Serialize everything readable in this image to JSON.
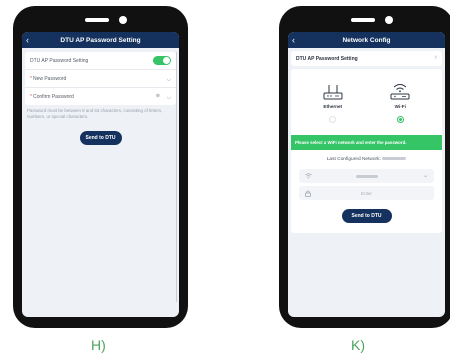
{
  "left_phone": {
    "header": {
      "back_icon": "chevron-left-icon",
      "title": "DTU AP Password Setting"
    },
    "settings": {
      "toggle_label": "DTU AP Password Setting",
      "toggle_on": true,
      "new_password": {
        "required_mark": "*",
        "placeholder": "New Password"
      },
      "confirm_password": {
        "required_mark": "*",
        "placeholder": "Confirm Password"
      }
    },
    "hint": "Password must be between 8 and 63 characters, consisting of letters, numbers, or special characters.",
    "send_button": "Send to DTU",
    "caption": "H)"
  },
  "right_phone": {
    "header": {
      "back_icon": "chevron-left-icon",
      "title": "Network Config"
    },
    "ap_row_label": "DTU AP Password Setting",
    "modes": [
      {
        "label": "Ethernet",
        "icon": "router-icon",
        "selected": false
      },
      {
        "label": "Wi-Fi",
        "icon": "wifi-router-icon",
        "selected": true
      }
    ],
    "banner": "Please select a WiFi network and enter the password.",
    "last_configured_label": "Last Configured Network:",
    "password_placeholder": "Enter",
    "send_button": "Send to DTU",
    "caption": "K)"
  },
  "colors": {
    "nav": "#15325f",
    "accent_green": "#35c466",
    "caption_green": "#4ca45c",
    "screen_bg": "#eef1f6"
  }
}
